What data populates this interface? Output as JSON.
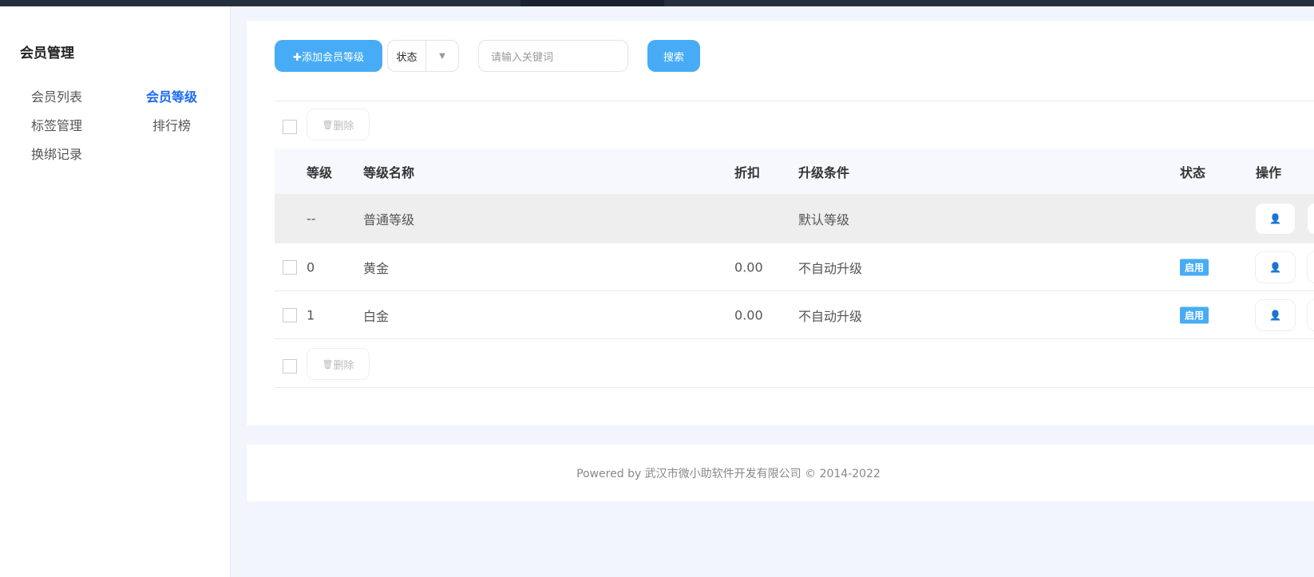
{
  "sidebar": {
    "title": "会员管理",
    "items": [
      {
        "label": "会员列表",
        "active": false
      },
      {
        "label": "会员等级",
        "active": true
      },
      {
        "label": "标签管理",
        "active": false
      },
      {
        "label": "排行榜",
        "active": false
      },
      {
        "label": "换绑记录",
        "active": false
      }
    ]
  },
  "toolbar": {
    "add_label": "✚添加会员等级",
    "status_label": "状态",
    "status_arrow": "▼",
    "search_placeholder": "请输入关键词",
    "search_label": "搜索"
  },
  "batch": {
    "delete_label": "删除",
    "delete_icon": "🗑"
  },
  "table": {
    "headers": [
      "等级",
      "等级名称",
      "折扣",
      "升级条件",
      "状态",
      "操作"
    ],
    "rows": [
      {
        "level": "--",
        "name": "普通等级",
        "discount": "",
        "condition": "默认等级",
        "status": "",
        "default": true
      },
      {
        "level": "0",
        "name": "黄金",
        "discount": "0.00",
        "condition": "不自动升级",
        "status": "启用"
      },
      {
        "level": "1",
        "name": "白金",
        "discount": "0.00",
        "condition": "不自动升级",
        "status": "启用"
      }
    ]
  },
  "colors": {
    "accent": "#47acf5",
    "active_nav": "#1b6bf0"
  },
  "footer": {
    "text": "Powered by 武汉市微小助软件开发有限公司 © 2014-2022"
  }
}
